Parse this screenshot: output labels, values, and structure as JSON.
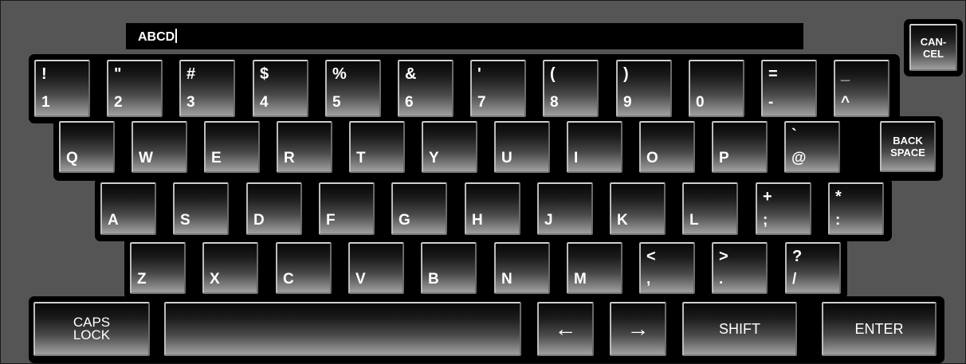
{
  "text_field": {
    "value": "ABCD"
  },
  "cancel_key": {
    "line1": "CAN-",
    "line2": "CEL"
  },
  "number_row": [
    {
      "shift": "!",
      "base": "1"
    },
    {
      "shift": "\"",
      "base": "2"
    },
    {
      "shift": "#",
      "base": "3"
    },
    {
      "shift": "$",
      "base": "4"
    },
    {
      "shift": "%",
      "base": "5"
    },
    {
      "shift": "&",
      "base": "6"
    },
    {
      "shift": "'",
      "base": "7"
    },
    {
      "shift": "(",
      "base": "8"
    },
    {
      "shift": ")",
      "base": "9"
    },
    {
      "shift": "",
      "base": "0"
    },
    {
      "shift": "=",
      "base": "-"
    },
    {
      "shift": "_",
      "base": "^"
    }
  ],
  "qwerty_row": [
    {
      "shift": "",
      "base": "Q"
    },
    {
      "shift": "",
      "base": "W"
    },
    {
      "shift": "",
      "base": "E"
    },
    {
      "shift": "",
      "base": "R"
    },
    {
      "shift": "",
      "base": "T"
    },
    {
      "shift": "",
      "base": "Y"
    },
    {
      "shift": "",
      "base": "U"
    },
    {
      "shift": "",
      "base": "I"
    },
    {
      "shift": "",
      "base": "O"
    },
    {
      "shift": "",
      "base": "P"
    },
    {
      "shift": "`",
      "base": "@"
    }
  ],
  "backspace_key": {
    "line1": "BACK",
    "line2": "SPACE"
  },
  "home_row": [
    {
      "shift": "",
      "base": "A"
    },
    {
      "shift": "",
      "base": "S"
    },
    {
      "shift": "",
      "base": "D"
    },
    {
      "shift": "",
      "base": "F"
    },
    {
      "shift": "",
      "base": "G"
    },
    {
      "shift": "",
      "base": "H"
    },
    {
      "shift": "",
      "base": "J"
    },
    {
      "shift": "",
      "base": "K"
    },
    {
      "shift": "",
      "base": "L"
    },
    {
      "shift": "+",
      "base": ";"
    },
    {
      "shift": "*",
      "base": ":"
    }
  ],
  "bottom_row": [
    {
      "shift": "",
      "base": "Z"
    },
    {
      "shift": "",
      "base": "X"
    },
    {
      "shift": "",
      "base": "C"
    },
    {
      "shift": "",
      "base": "V"
    },
    {
      "shift": "",
      "base": "B"
    },
    {
      "shift": "",
      "base": "N"
    },
    {
      "shift": "",
      "base": "M"
    },
    {
      "shift": "<",
      "base": ","
    },
    {
      "shift": ">",
      "base": "."
    },
    {
      "shift": "?",
      "base": "/"
    }
  ],
  "function_row": {
    "caps_lock": {
      "line1": "CAPS",
      "line2": "LOCK"
    },
    "space": "",
    "left_arrow": "←",
    "right_arrow": "→",
    "shift": "SHIFT",
    "enter": "ENTER"
  }
}
